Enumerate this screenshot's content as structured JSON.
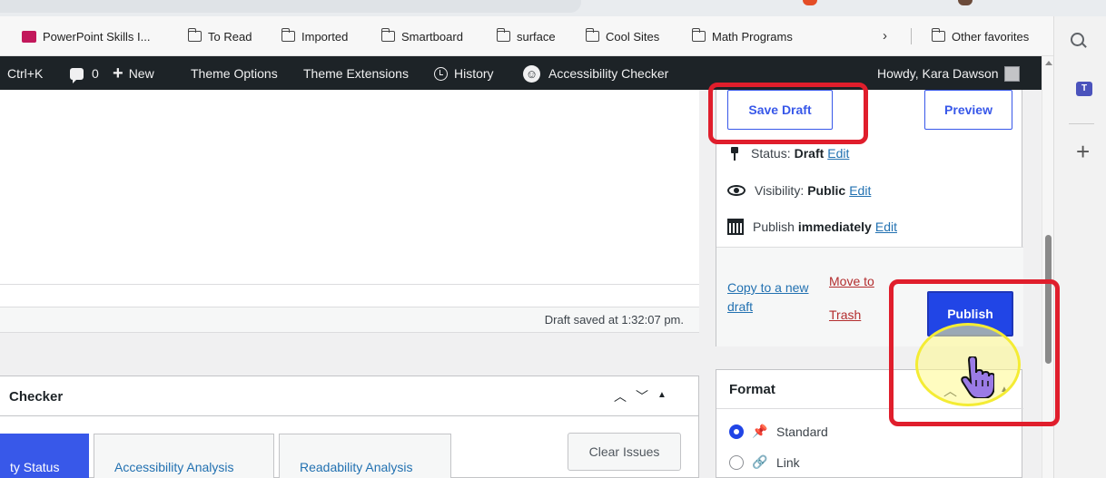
{
  "favorites_bar": {
    "items": [
      {
        "label": "PowerPoint Skills I...",
        "icon": "powerpoint-icon"
      },
      {
        "label": "To Read",
        "icon": "folder-icon"
      },
      {
        "label": "Imported",
        "icon": "folder-icon"
      },
      {
        "label": "Smartboard",
        "icon": "folder-icon"
      },
      {
        "label": "surface",
        "icon": "folder-icon"
      },
      {
        "label": "Cool Sites",
        "icon": "folder-icon"
      },
      {
        "label": "Math Programs",
        "icon": "folder-icon"
      }
    ],
    "overflow": "›",
    "other_favorites": "Other favorites"
  },
  "admin_bar": {
    "shortcut": "Ctrl+K",
    "comments_count": "0",
    "new": "New",
    "theme_options": "Theme Options",
    "theme_extensions": "Theme Extensions",
    "history": "History",
    "accessibility_checker": "Accessibility Checker",
    "howdy": "Howdy, Kara Dawson"
  },
  "editor": {
    "draft_saved": "Draft saved at 1:32:07 pm."
  },
  "checker_panel": {
    "title": "Checker",
    "tabs": [
      "ty Status",
      "Accessibility Analysis",
      "Readability Analysis"
    ],
    "clear_issues": "Clear Issues"
  },
  "publish_box": {
    "save_draft": "Save Draft",
    "preview": "Preview",
    "status_label": "Status:",
    "status_value": "Draft",
    "visibility_label": "Visibility:",
    "visibility_value": "Public",
    "publish_label": "Publish",
    "publish_value": "immediately",
    "edit": "Edit",
    "copy_line1": "Copy to a new",
    "copy_line2": "draft",
    "move_line1": "Move to",
    "move_line2": "Trash",
    "publish_button": "Publish"
  },
  "format_box": {
    "title": "Format",
    "options": [
      "Standard",
      "Link"
    ],
    "selected": "Standard"
  },
  "colors": {
    "admin_bar": "#1d2327",
    "accent_blue": "#3858e9",
    "highlight_red": "#e01e2c",
    "cursor_yellow": "#f4ec34"
  }
}
